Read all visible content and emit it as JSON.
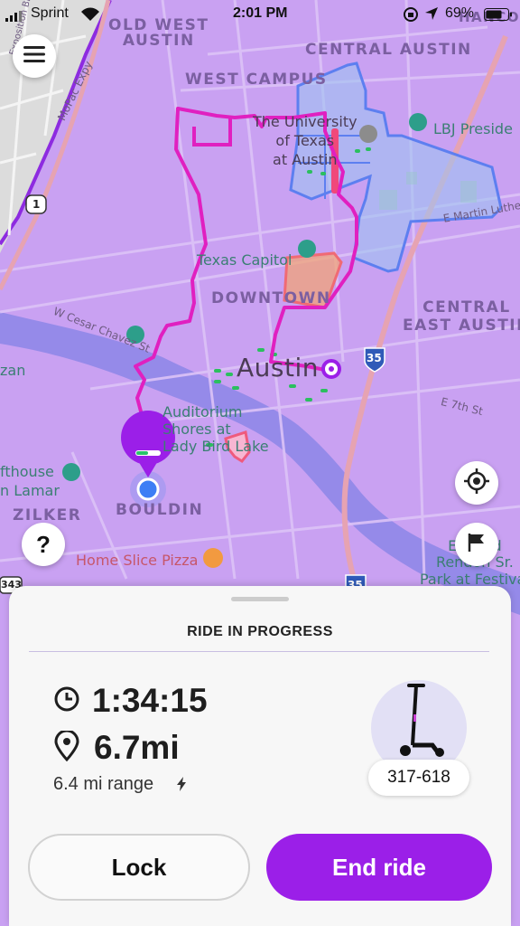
{
  "status_bar": {
    "carrier": "Sprint",
    "time": "2:01 PM",
    "battery": "69%"
  },
  "map": {
    "districts": {
      "old_west_austin": "OLD WEST\nAUSTIN",
      "central_austin": "CENTRAL AUSTIN",
      "hancock": "HANCOCK",
      "west_campus": "WEST CAMPUS",
      "downtown": "DOWNTOWN",
      "central_east_austin": "CENTRAL\nEAST AUSTIN",
      "zilker": "ZILKER",
      "bouldin": "BOULDIN"
    },
    "pois": {
      "university": "The University\nof Texas\nat Austin",
      "lbj": "LBJ Preside",
      "capitol": "Texas Capitol",
      "auditorium": "Auditorium\nShores at\nLady Bird Lake",
      "home_slice": "Home Slice Pizza",
      "waterloo": "Edward\nRendon Sr.\nPark at Festival",
      "firehouse": "fthouse\nn Lamar",
      "plaza": "zan"
    },
    "city_label": "Austin",
    "streets": {
      "mopac": "MoPac Expy",
      "cesar_chavez": "W Cesar Chavez St",
      "mlk": "E Martin Luther Kin",
      "e7th": "E 7th St",
      "exposition": "Exposition Blvd"
    },
    "shields": {
      "i35_a": "35",
      "i35_b": "35",
      "route1": "1",
      "hwy343": "343"
    }
  },
  "ride": {
    "title": "RIDE IN PROGRESS",
    "duration": "1:34:15",
    "distance": "6.7mi",
    "range": "6.4 mi range",
    "scooter_id": "317-618",
    "lock_label": "Lock",
    "end_label": "End ride"
  },
  "colors": {
    "accent": "#9b1fe8",
    "route": "#e020c0",
    "map_overlay": "#c59af0",
    "restricted_zone": "#f07a6e",
    "no_ride_zone": "#6b8cff"
  },
  "icons": {
    "menu": "hamburger-menu-icon",
    "help": "question-mark-icon",
    "locate": "crosshair-icon",
    "report": "flag-icon",
    "timer": "clock-icon",
    "location": "map-pin-icon",
    "charge": "lightning-icon"
  }
}
